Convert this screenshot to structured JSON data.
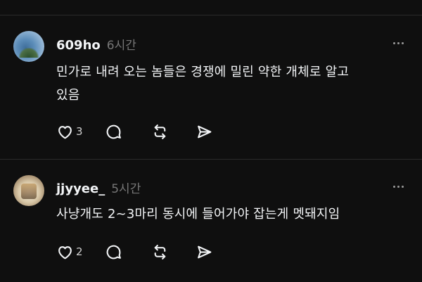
{
  "posts": [
    {
      "username": "609ho",
      "time": "6시간",
      "text": "민가로 내려 오는 놈들은 경쟁에 밀린 약한 개체로 알고\n있음",
      "like_count": "3",
      "avatar": "landscape-photo"
    },
    {
      "username": "jjyyee_",
      "time": "5시간",
      "text": "사냥개도 2~3마리 동시에 들어가야 잡는게 멧돼지임",
      "like_count": "2",
      "avatar": "cup-photo"
    }
  ],
  "icons": {
    "like": "heart-icon",
    "comment": "comment-icon",
    "repost": "repost-icon",
    "share": "send-icon",
    "more": "more-icon"
  }
}
